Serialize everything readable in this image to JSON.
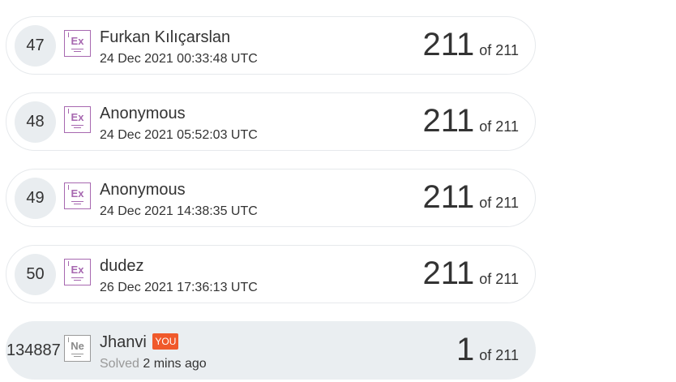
{
  "rows": [
    {
      "rank": "47",
      "badge": "Ex",
      "name": "Furkan Kılıçarslan",
      "date": "24 Dec 2021 00:33:48 UTC",
      "score": "211",
      "of": "of 211"
    },
    {
      "rank": "48",
      "badge": "Ex",
      "name": "Anonymous",
      "date": "24 Dec 2021 05:52:03 UTC",
      "score": "211",
      "of": "of 211"
    },
    {
      "rank": "49",
      "badge": "Ex",
      "name": "Anonymous",
      "date": "24 Dec 2021 14:38:35 UTC",
      "score": "211",
      "of": "of 211"
    },
    {
      "rank": "50",
      "badge": "Ex",
      "name": "dudez",
      "date": "26 Dec 2021 17:36:13 UTC",
      "score": "211",
      "of": "of 211"
    }
  ],
  "me": {
    "rank": "134887",
    "badge": "Ne",
    "name": "Jhanvi",
    "you_tag": "YOU",
    "solved_label": "Solved",
    "solved_time": "2 mins ago",
    "score": "1",
    "of": "of 211"
  },
  "colors": {
    "badge_expert": "#a768b0",
    "badge_newbie": "#9a9a9a",
    "you_tag_bg": "#f0592b",
    "highlight_row_bg": "#eaeef1"
  }
}
